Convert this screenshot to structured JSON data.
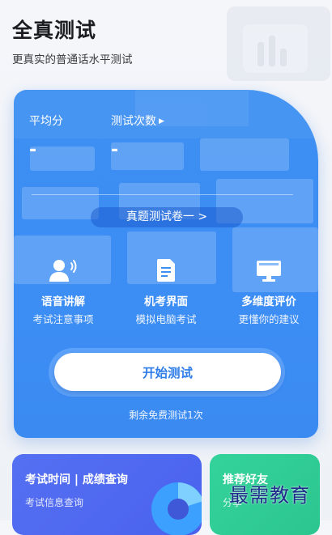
{
  "header": {
    "title": "全真测试",
    "subtitle": "更真实的普通话水平测试"
  },
  "stats": {
    "avg_label": "平均分",
    "avg_value": "-",
    "count_label": "测试次数",
    "count_value": "-"
  },
  "paper_selector": {
    "label": "真题测试卷一 >"
  },
  "features": [
    {
      "icon": "person-voice-icon",
      "title": "语音讲解",
      "subtitle": "考试注意事项"
    },
    {
      "icon": "document-icon",
      "title": "机考界面",
      "subtitle": "模拟电脑考试"
    },
    {
      "icon": "monitor-icon",
      "title": "多维度评价",
      "subtitle": "更懂你的建议"
    }
  ],
  "start_button": {
    "label": "开始测试"
  },
  "free_note": "剩余免费测试1次",
  "bottom_cards": {
    "exam": {
      "title": "考试时间 | 成绩查询",
      "subtitle": "考试信息查询"
    },
    "friend": {
      "title": "推荐好友",
      "subtitle": "分享"
    }
  },
  "watermark": "最需教育",
  "colors": {
    "card_blue": "#3d8ff2",
    "button_text": "#2f7de8",
    "exam_card": "#5570f2",
    "friend_card": "#34d39c",
    "watermark": "#1e2a8a"
  }
}
